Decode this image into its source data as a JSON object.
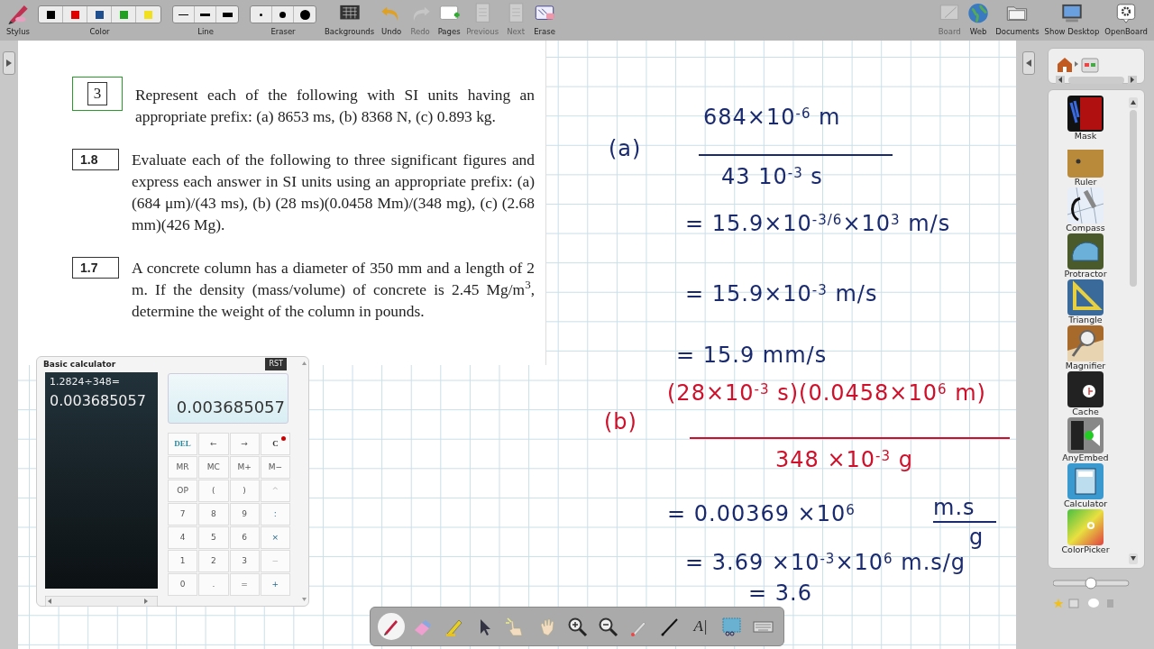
{
  "toolbar": {
    "left": [
      {
        "kind": "button",
        "label": "Stylus",
        "disabled": false
      },
      {
        "kind": "swatches",
        "label": "Color",
        "swatches": [
          {
            "color": "#000000"
          },
          {
            "color": "#e00000"
          },
          {
            "color": "#1f4f8f"
          },
          {
            "color": "#22a022"
          },
          {
            "color": "#f0e020"
          }
        ]
      },
      {
        "kind": "sizes",
        "label": "Line"
      },
      {
        "kind": "sizes",
        "label": "Eraser"
      },
      {
        "kind": "button",
        "label": "Backgrounds",
        "disabled": false
      },
      {
        "kind": "button",
        "label": "Undo",
        "disabled": false
      },
      {
        "kind": "button",
        "label": "Redo",
        "disabled": true
      },
      {
        "kind": "button",
        "label": "Pages",
        "disabled": false
      },
      {
        "kind": "button",
        "label": "Previous",
        "disabled": true
      },
      {
        "kind": "button",
        "label": "Next",
        "disabled": true
      },
      {
        "kind": "button",
        "label": "Erase",
        "disabled": false
      }
    ],
    "right": [
      {
        "kind": "button",
        "label": "Board",
        "disabled": true
      },
      {
        "kind": "button",
        "label": "Web",
        "disabled": false
      },
      {
        "kind": "button",
        "label": "Documents",
        "disabled": false
      },
      {
        "kind": "button",
        "label": "Show Desktop",
        "disabled": false
      },
      {
        "kind": "button",
        "label": "OpenBoard",
        "disabled": false
      }
    ]
  },
  "document": {
    "problems": [
      {
        "number": "3",
        "text": "Represent each of the following with SI units having an appropriate prefix: (a) 8653 ms, (b) 8368 N, (c) 0.893 kg."
      },
      {
        "number": "1.8",
        "text": "Evaluate each of the following to three significant figures and express each answer in SI units using an appropriate prefix: (a) (684 μm)/(43 ms), (b) (28 ms)(0.0458 Mm)/(348 mg), (c) (2.68 mm)(426 Mg)."
      },
      {
        "number": "1.7",
        "text": "A concrete column has a diameter of 350 mm and a length of 2 m. If the density (mass/volume) of concrete is 2.45 Mg/m$^{3}$, determine the weight of the column in pounds."
      }
    ]
  },
  "handwriting": [
    {
      "kind": "text",
      "color": "#1a2a6e",
      "text": "(a)"
    },
    {
      "kind": "text",
      "color": "#1a2a6e",
      "text": "684×10$^{-6}$ m"
    },
    {
      "kind": "rule",
      "color": "#1a2a6e"
    },
    {
      "kind": "text",
      "color": "#1a2a6e",
      "text": "43 10$^{-3}$ s"
    },
    {
      "kind": "text",
      "color": "#1a2a6e",
      "text": "= 15.9×10$^{-3/6}$×10$^{3}$ m/s"
    },
    {
      "kind": "text",
      "color": "#1a2a6e",
      "text": "= 15.9×10$^{-3}$ m/s"
    },
    {
      "kind": "text",
      "color": "#1a2a6e",
      "text": "= 15.9 mm/s"
    },
    {
      "kind": "text",
      "color": "#d0102a",
      "text": "(b)"
    },
    {
      "kind": "text",
      "color": "#d0102a",
      "text": "(28×10$^{-3}$ s)(0.0458×10$^{6}$ m)"
    },
    {
      "kind": "rule",
      "color": "#d0102a"
    },
    {
      "kind": "text",
      "color": "#d0102a",
      "text": "348 ×10$^{-3}$ g"
    },
    {
      "kind": "text",
      "color": "#1a2a6e",
      "text": "= 0.00369 ×10$^{6}$"
    },
    {
      "kind": "text",
      "color": "#1a2a6e",
      "text": "m.s"
    },
    {
      "kind": "rule",
      "color": "#1a2a6e"
    },
    {
      "kind": "text",
      "color": "#1a2a6e",
      "text": "g"
    },
    {
      "kind": "text",
      "color": "#1a2a6e",
      "text": "= 3.69 ×10$^{-3}$×10$^{6}$ m.s/g"
    },
    {
      "kind": "text",
      "color": "#1a2a6e",
      "text": "= 3.6"
    }
  ],
  "calculator": {
    "title": "Basic calculator",
    "reset": "RST",
    "history": "1.2824÷348=",
    "history_result": "0.003685057",
    "display": "0.003685057",
    "keys": [
      {
        "label": "DEL",
        "kind": "del"
      },
      {
        "label": "←",
        "kind": "plain"
      },
      {
        "label": "→",
        "kind": "plain"
      },
      {
        "label": "C",
        "kind": "clear"
      },
      {
        "label": "MR",
        "kind": "plain"
      },
      {
        "label": "MC",
        "kind": "plain"
      },
      {
        "label": "M+",
        "kind": "plain"
      },
      {
        "label": "M−",
        "kind": "plain"
      },
      {
        "label": "OP",
        "kind": "plain"
      },
      {
        "label": "(",
        "kind": "plain"
      },
      {
        "label": ")",
        "kind": "plain"
      },
      {
        "label": "^",
        "kind": "faint"
      },
      {
        "label": "7",
        "kind": "plain"
      },
      {
        "label": "8",
        "kind": "plain"
      },
      {
        "label": "9",
        "kind": "plain"
      },
      {
        "label": ":",
        "kind": "op"
      },
      {
        "label": "4",
        "kind": "plain"
      },
      {
        "label": "5",
        "kind": "plain"
      },
      {
        "label": "6",
        "kind": "plain"
      },
      {
        "label": "×",
        "kind": "op"
      },
      {
        "label": "1",
        "kind": "plain"
      },
      {
        "label": "2",
        "kind": "plain"
      },
      {
        "label": "3",
        "kind": "plain"
      },
      {
        "label": "−",
        "kind": "faint"
      },
      {
        "label": "0",
        "kind": "plain"
      },
      {
        "label": ".",
        "kind": "plain"
      },
      {
        "label": "=",
        "kind": "plain"
      },
      {
        "label": "+",
        "kind": "op"
      }
    ]
  },
  "library": {
    "zoom": {
      "level": 0.5
    },
    "items": [
      {
        "label": "Mask"
      },
      {
        "label": "Ruler"
      },
      {
        "label": "Compass"
      },
      {
        "label": "Protractor"
      },
      {
        "label": "Triangle"
      },
      {
        "label": "Magnifier"
      },
      {
        "label": "Cache"
      },
      {
        "label": "AnyEmbed"
      },
      {
        "label": "Calculator"
      },
      {
        "label": "ColorPicker"
      }
    ]
  },
  "tools": [
    {
      "selected": true
    },
    {
      "selected": false
    },
    {
      "selected": false
    },
    {
      "selected": false
    },
    {
      "selected": false
    },
    {
      "selected": false
    },
    {
      "selected": false
    },
    {
      "selected": false
    },
    {
      "selected": false
    },
    {
      "selected": false
    },
    {
      "selected": false,
      "glyph": "A|"
    },
    {
      "selected": false
    },
    {
      "selected": false
    }
  ]
}
